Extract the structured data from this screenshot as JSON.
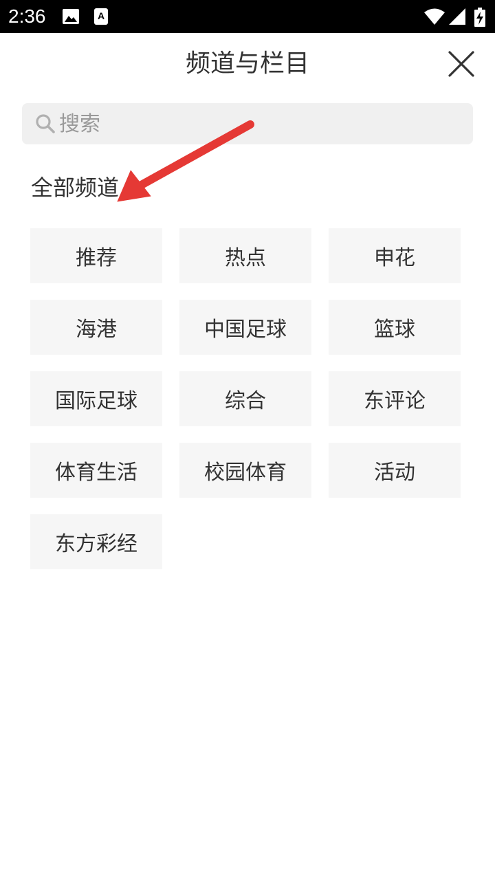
{
  "status_bar": {
    "time": "2:36",
    "icons": [
      "image-icon",
      "font-icon",
      "wifi-icon",
      "signal-icon",
      "battery-charging-icon"
    ]
  },
  "header": {
    "title": "频道与栏目",
    "close_icon": "close-icon"
  },
  "search": {
    "placeholder": "搜索",
    "icon": "search-icon"
  },
  "section": {
    "title": "全部频道"
  },
  "channels": [
    "推荐",
    "热点",
    "申花",
    "海港",
    "中国足球",
    "篮球",
    "国际足球",
    "综合",
    "东评论",
    "体育生活",
    "校园体育",
    "活动",
    "东方彩经"
  ],
  "colors": {
    "accent_arrow": "#e53935",
    "chip_bg": "#f6f6f6",
    "search_bg": "#f0f0f0",
    "text": "#333333"
  }
}
